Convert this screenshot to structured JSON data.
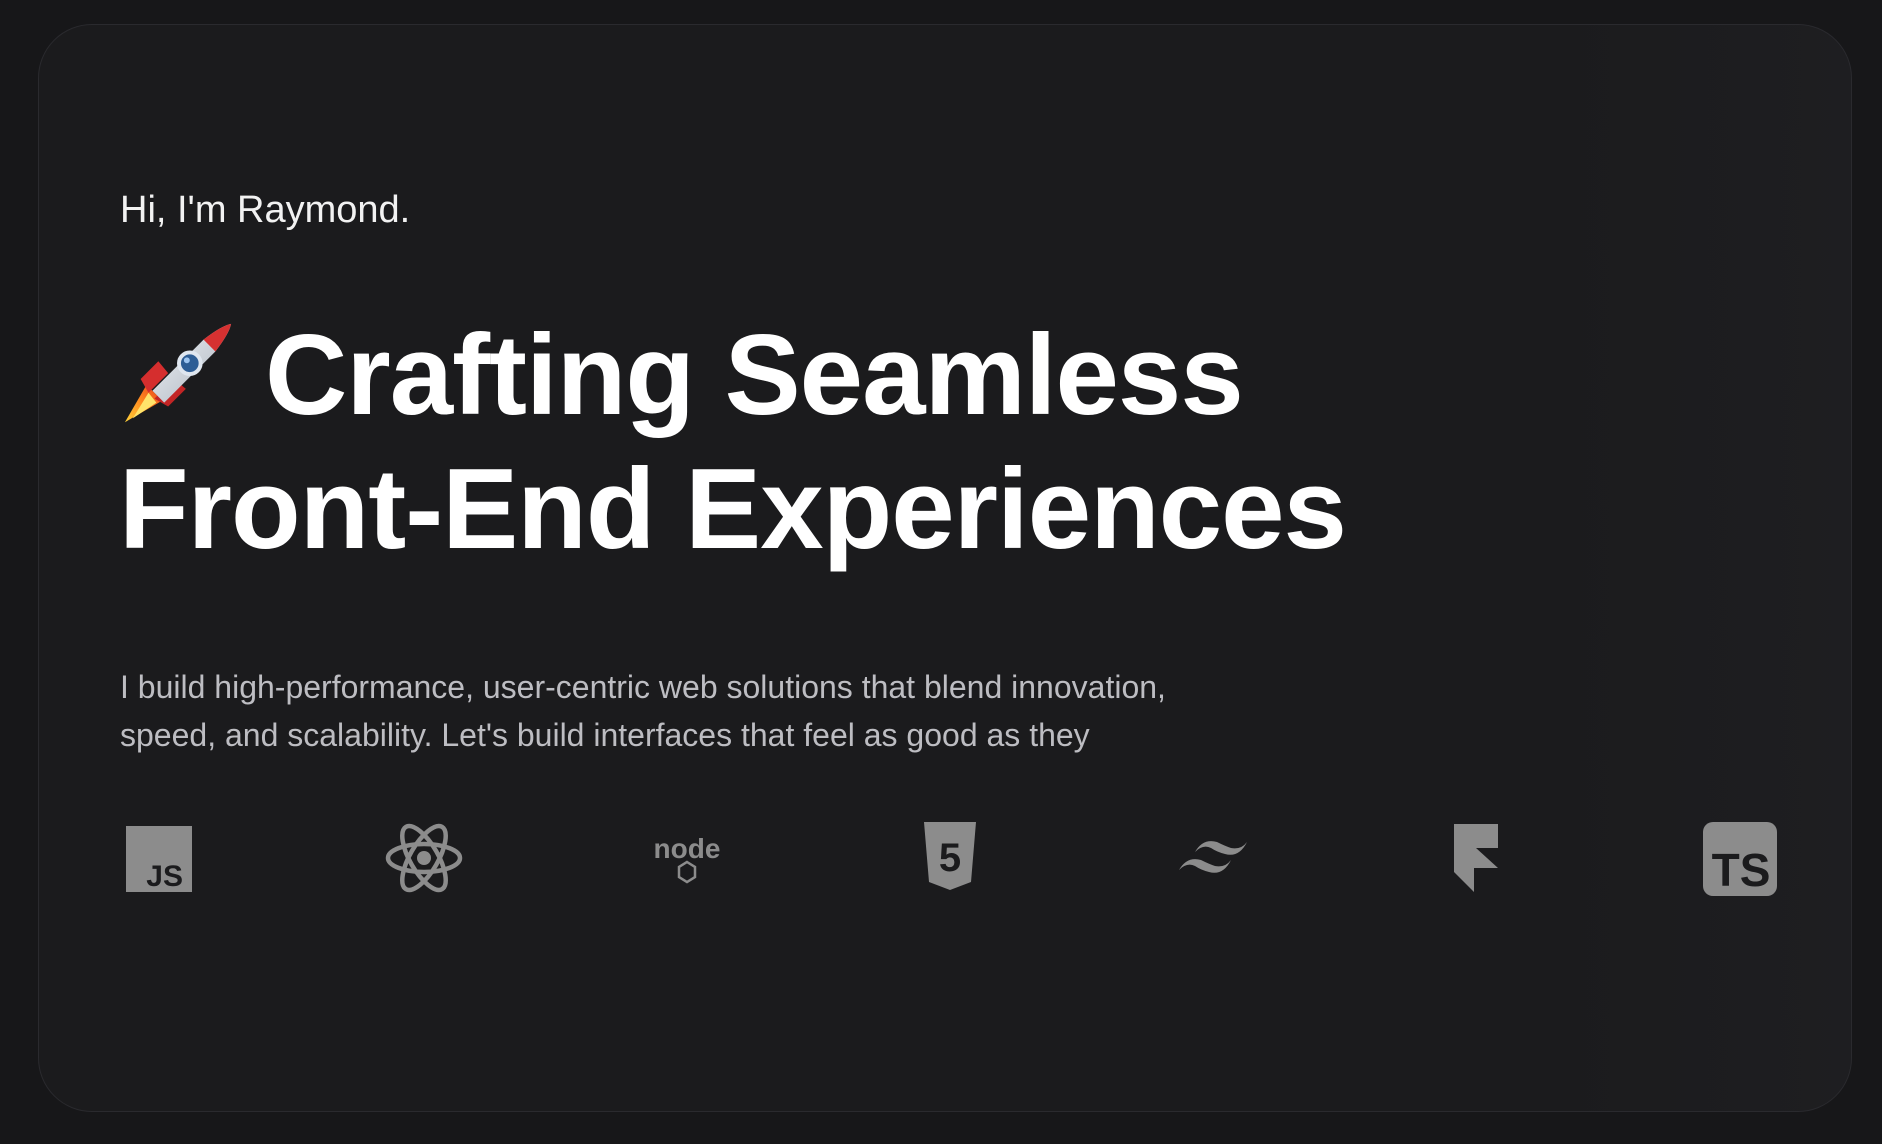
{
  "hero": {
    "greeting": "Hi, I'm Raymond.",
    "headline_emoji": "rocket-icon",
    "headline_line1": "Crafting Seamless",
    "headline_line2": "Front-End Experiences",
    "subtitle": "I build high-performance, user-centric web solutions that blend innovation, speed, and scalability. Let's build interfaces that feel as good as they"
  },
  "tech_icons": [
    {
      "name": "javascript-icon",
      "text": "JS"
    },
    {
      "name": "react-icon"
    },
    {
      "name": "nodejs-icon",
      "text": "node"
    },
    {
      "name": "html5-icon",
      "text": "5"
    },
    {
      "name": "tailwind-icon"
    },
    {
      "name": "framer-icon"
    },
    {
      "name": "typescript-icon",
      "text": "TS"
    }
  ],
  "colors": {
    "background": "#171719",
    "card": "#1b1b1d",
    "text_primary": "#ffffff",
    "text_secondary": "#bdbdc2",
    "icon_gray": "#8c8c8c"
  }
}
